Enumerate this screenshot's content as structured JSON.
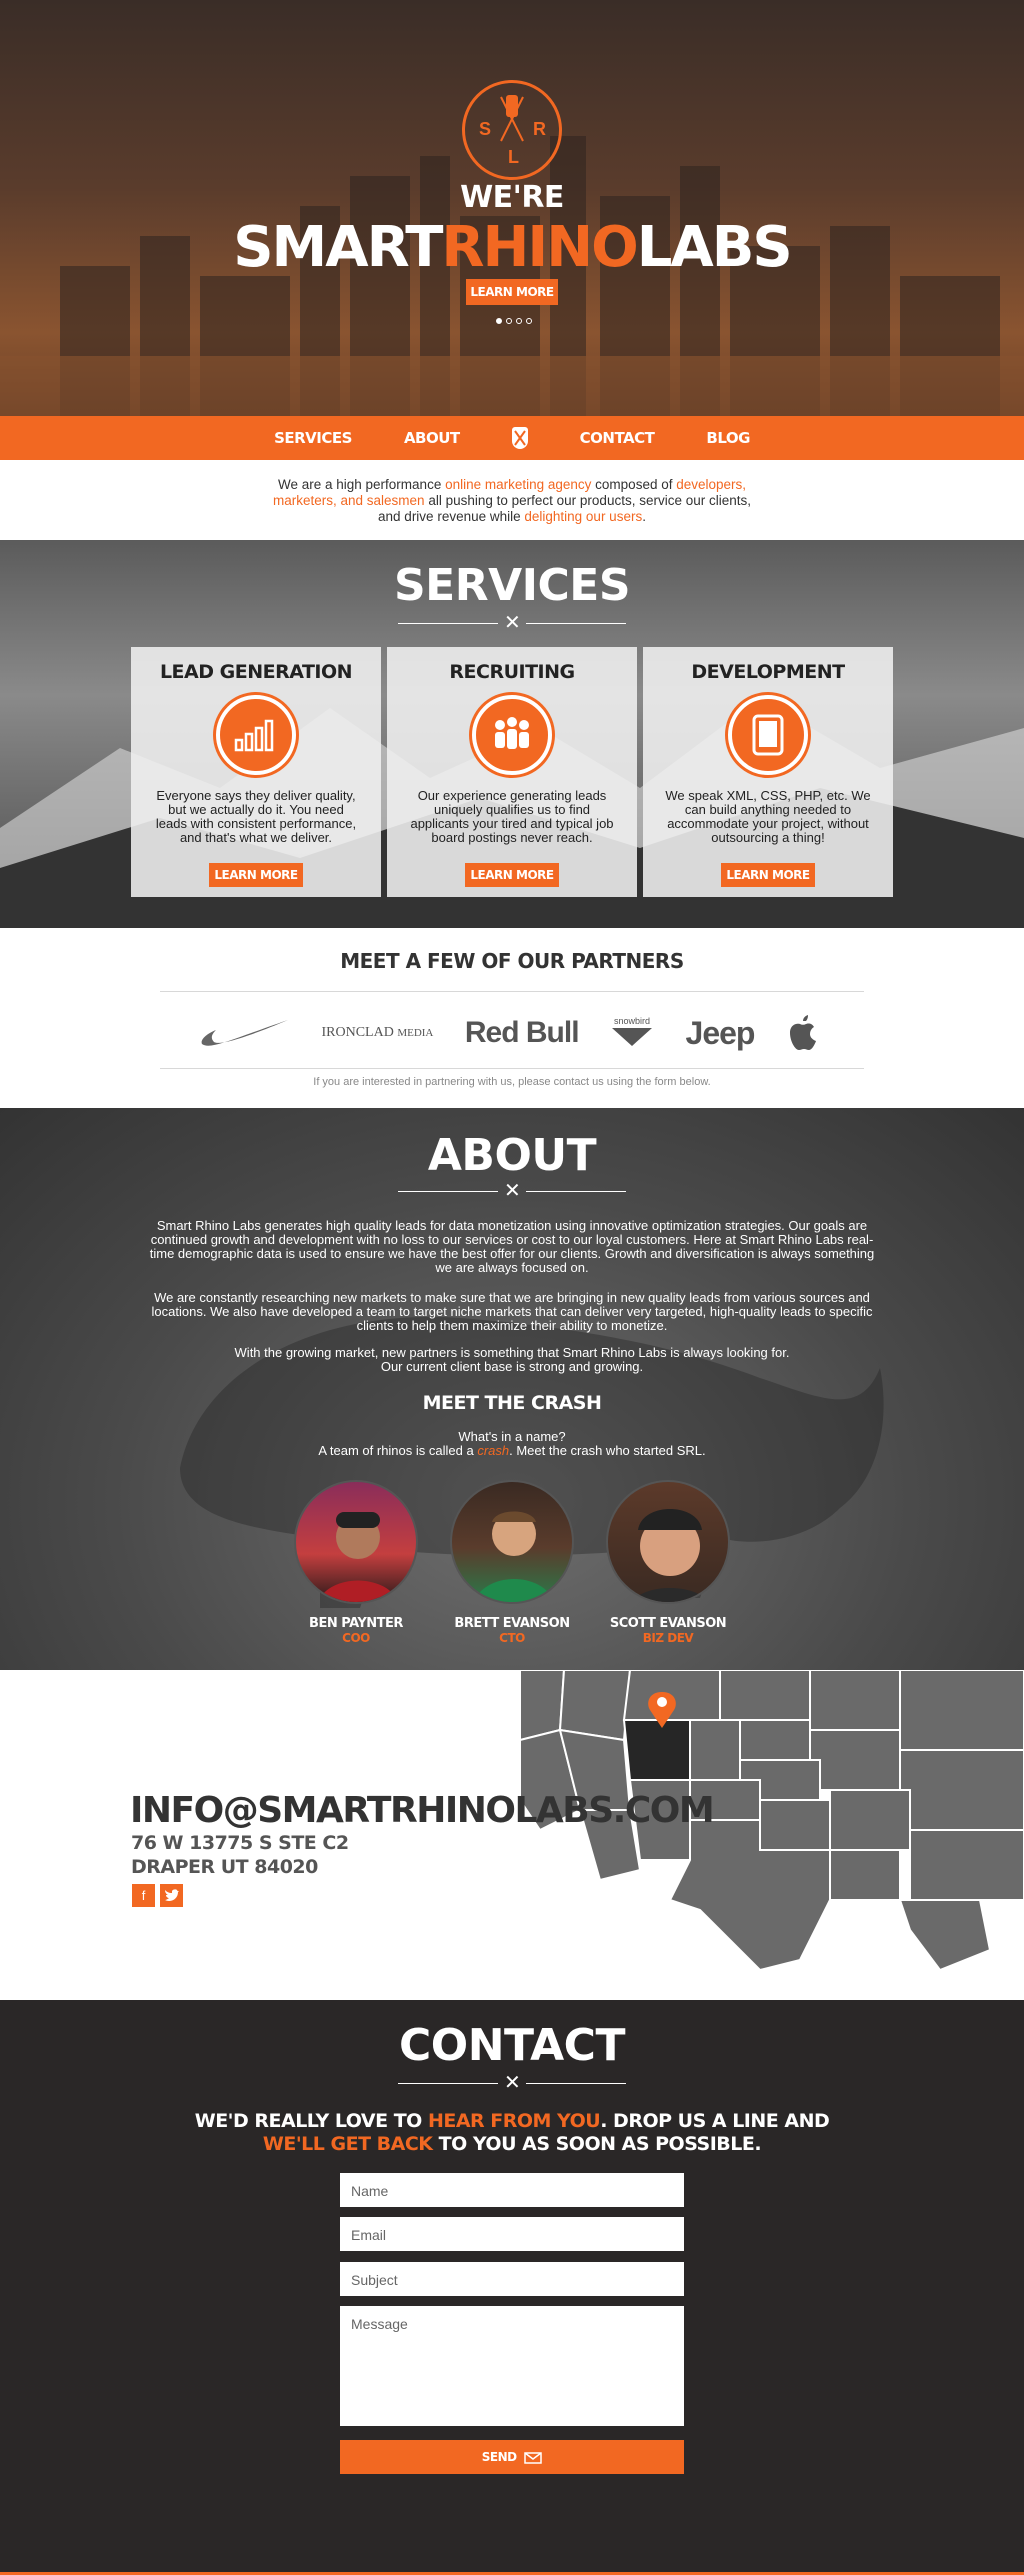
{
  "hero": {
    "logo_letters": [
      "S",
      "R",
      "L"
    ],
    "tagline": "WE'RE",
    "brand_part1": "SMART",
    "brand_part2": "RHINO",
    "brand_part3": "LABS",
    "button_label": "LEARN MORE",
    "slides": 4,
    "active_slide": 1
  },
  "nav": {
    "items": [
      "SERVICES",
      "ABOUT",
      "CONTACT",
      "BLOG"
    ]
  },
  "intro": {
    "t1": "We are a high performance ",
    "l1": "online marketing agency",
    "t2": " composed of ",
    "l2": "developers,",
    "l3": "marketers, and salesmen",
    "t3": " all pushing to perfect our products, service our clients,",
    "t4": "and drive revenue while ",
    "l4": "delighting our users",
    "t5": "."
  },
  "services": {
    "title": "SERVICES",
    "cards": [
      {
        "heading": "LEAD GENERATION",
        "icon": "bar-chart-icon",
        "text": "Everyone says they deliver quality, but we actually do it. You need leads with consistent performance, and that's what we deliver.",
        "button": "LEARN MORE"
      },
      {
        "heading": "RECRUITING",
        "icon": "people-icon",
        "text": "Our experience generating leads uniquely qualifies us to find applicants your tired and typical job board postings never reach.",
        "button": "LEARN MORE"
      },
      {
        "heading": "DEVELOPMENT",
        "icon": "tablet-icon",
        "text": "We speak XML, CSS, PHP, etc. We can build anything needed to accommodate your project, without outsourcing a thing!",
        "button": "LEARN MORE"
      }
    ]
  },
  "partners": {
    "heading": "MEET A FEW OF OUR PARTNERS",
    "logos": [
      "nike-logo",
      "IRONCLAD MEDIA",
      "Red Bull",
      "snowbird",
      "Jeep",
      "apple-logo"
    ],
    "ironclad_a": "IRONCLAD",
    "ironclad_b": "MEDIA",
    "redbull": "Red Bull",
    "snowbird": "snowbird",
    "jeep": "Jeep",
    "note": "If you are interested in partnering with us, please contact us using the form below."
  },
  "about": {
    "title": "ABOUT",
    "p1": "Smart Rhino Labs generates high quality leads for data monetization using innovative optimization strategies. Our goals are continued growth and development with no loss to our services or cost to our loyal customers. Here at Smart Rhino Labs real-time demographic data is used to ensure we have the best offer for our clients. Growth and diversification is always something we are always focused on.",
    "p2": "We are constantly researching new markets to make sure that we are bringing in new quality leads from various sources and locations. We also have developed a team to target niche markets that can deliver very targeted, high-quality leads to specific clients to help them maximize their ability to monetize.",
    "p3a": "With the growing market, new partners is something that Smart Rhino Labs is always looking for.",
    "p3b": "Our current client base is strong and growing.",
    "crash_heading": "MEET THE CRASH",
    "crash_q": "What's in a name?",
    "crash_t1": "A team of rhinos is called a ",
    "crash_link": "crash",
    "crash_t2": ". Meet the crash who started SRL.",
    "team": [
      {
        "name": "BEN PAYNTER",
        "role": "COO"
      },
      {
        "name": "BRETT EVANSON",
        "role": "CTO"
      },
      {
        "name": "SCOTT EVANSON",
        "role": "BIZ DEV"
      }
    ]
  },
  "location": {
    "email": "INFO@SMARTRHINOLABS.COM",
    "address1": "76 W 13775 S STE C2",
    "address2": "DRAPER UT 84020",
    "social": [
      "facebook-icon",
      "twitter-icon"
    ]
  },
  "contact": {
    "title": "CONTACT",
    "line1_a": "WE'D REALLY LOVE TO ",
    "line1_b": "HEAR FROM YOU",
    "line1_c": ". DROP US A LINE AND",
    "line2_a": "WE'LL GET BACK",
    "line2_b": " TO YOU AS SOON AS POSSIBLE.",
    "fields": {
      "name": "Name",
      "email": "Email",
      "subject": "Subject",
      "message": "Message"
    },
    "send_label": "SEND"
  },
  "colors": {
    "accent": "#f26822",
    "dark": "#2a2727"
  }
}
